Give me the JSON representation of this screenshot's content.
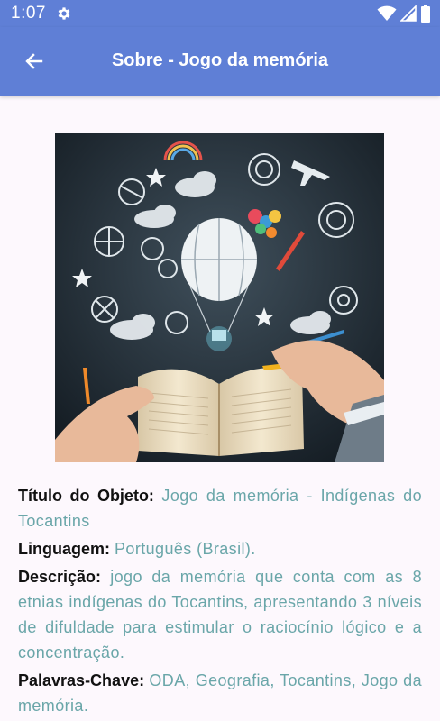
{
  "status_bar": {
    "time": "1:07",
    "icons": [
      "gear-icon",
      "wifi-icon",
      "signal-icon",
      "battery-icon"
    ]
  },
  "app_bar": {
    "title": "Sobre - Jogo da memória",
    "back_icon": "arrow-left-icon",
    "color": "#5f7fd6"
  },
  "hero_image": {
    "description_icon": "illustration-open-book-with-balloon-and-doodles"
  },
  "details": {
    "title_label": "Título do Objeto:",
    "title_value": "Jogo da memória - Indígenas do Tocantins",
    "language_label": "Linguagem:",
    "language_value": "Português (Brasil).",
    "description_label": "Descrição:",
    "description_value": "jogo da memória que conta com as 8 etnias indígenas do Tocantins, apresentando 3 níveis de difuldade para estimular o raciocínio lógico e a concentração.",
    "keywords_label": "Palavras-Chave:",
    "keywords_value": "ODA, Geografia, Tocantins, Jogo da memória."
  },
  "colors": {
    "label": "#111111",
    "value": "#6aa6a9",
    "background": "#fdf8fd"
  }
}
